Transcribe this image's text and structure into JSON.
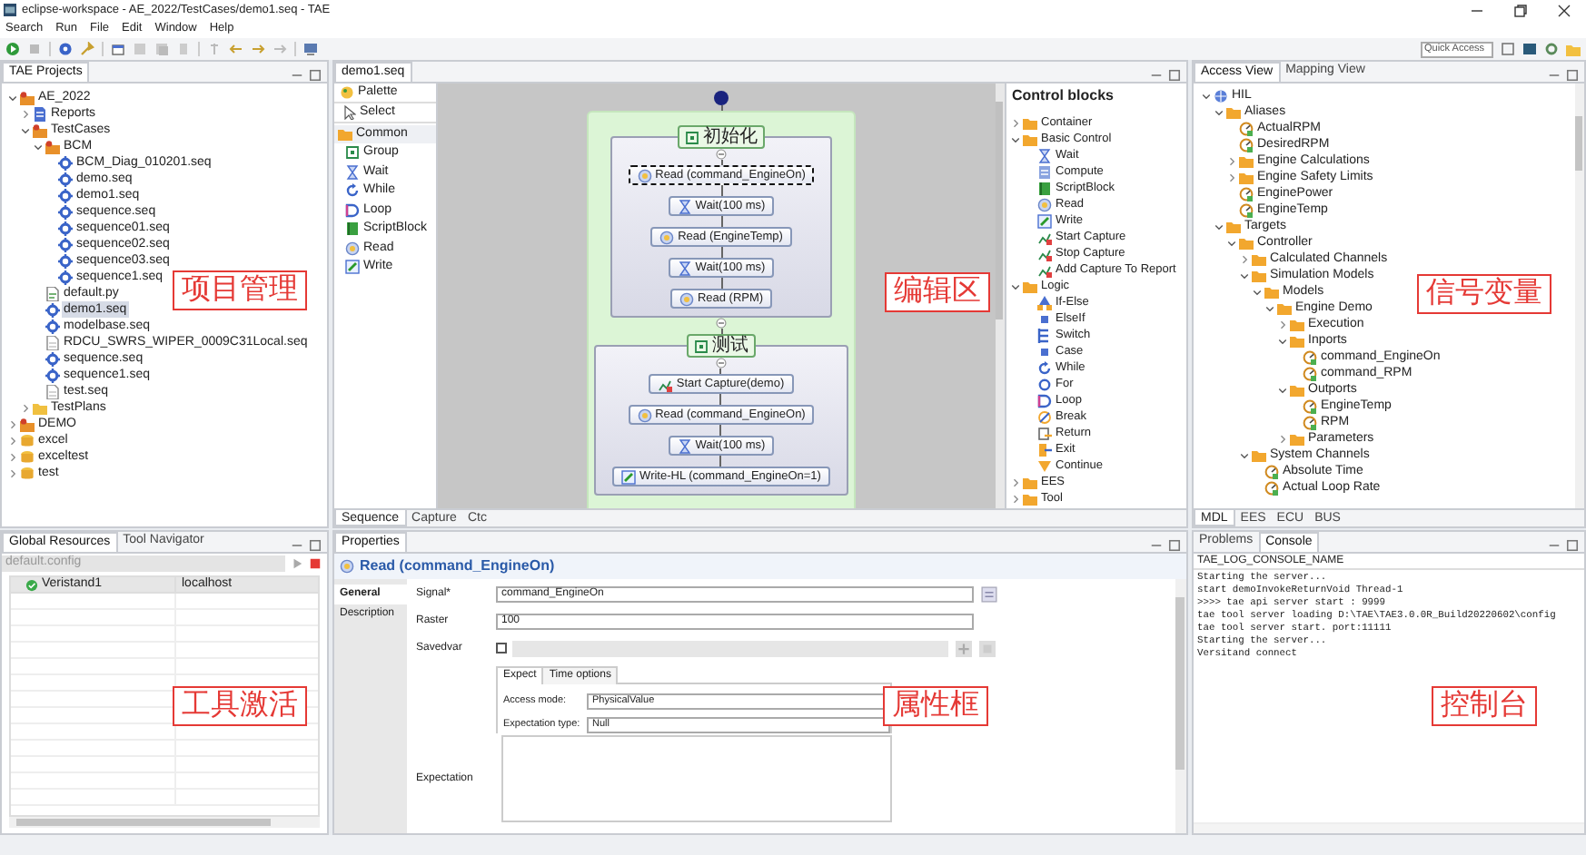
{
  "window": {
    "title": "eclipse-workspace - AE_2022/TestCases/demo1.seq - TAE"
  },
  "menu": [
    "Search",
    "Run",
    "File",
    "Edit",
    "Window",
    "Help"
  ],
  "quick_access": {
    "placeholder": "Quick Access"
  },
  "projects": {
    "tabs": [
      {
        "label": "TAE Projects",
        "selected": true
      }
    ],
    "annotation": "项目管理",
    "tree": [
      {
        "label": "AE_2022",
        "kind": "project",
        "expanded": true,
        "selected": false,
        "children": [
          {
            "label": "Reports",
            "kind": "report",
            "expanded": false,
            "selected": false
          },
          {
            "label": "TestCases",
            "kind": "project",
            "expanded": true,
            "selected": false,
            "children": [
              {
                "label": "BCM",
                "kind": "project",
                "expanded": true,
                "selected": false,
                "children": [
                  {
                    "label": "BCM_Diag_010201.seq",
                    "kind": "seq",
                    "selected": false
                  },
                  {
                    "label": "demo.seq",
                    "kind": "seq",
                    "selected": false
                  },
                  {
                    "label": "demo1.seq",
                    "kind": "seq",
                    "selected": false
                  },
                  {
                    "label": "sequence.seq",
                    "kind": "seq",
                    "selected": false
                  },
                  {
                    "label": "sequence01.seq",
                    "kind": "seq",
                    "selected": false
                  },
                  {
                    "label": "sequence02.seq",
                    "kind": "seq",
                    "selected": false
                  },
                  {
                    "label": "sequence03.seq",
                    "kind": "seq",
                    "selected": false
                  },
                  {
                    "label": "sequence1.seq",
                    "kind": "seq",
                    "selected": false
                  }
                ]
              },
              {
                "label": "default.py",
                "kind": "py",
                "selected": false
              },
              {
                "label": "demo1.seq",
                "kind": "seq",
                "selected": true
              },
              {
                "label": "modelbase.seq",
                "kind": "seq",
                "selected": false
              },
              {
                "label": "RDCU_SWRS_WIPER_0009C31Local.seq",
                "kind": "file",
                "selected": false
              },
              {
                "label": "sequence.seq",
                "kind": "seq",
                "selected": false
              },
              {
                "label": "sequence1.seq",
                "kind": "seq",
                "selected": false
              },
              {
                "label": "test.seq",
                "kind": "file",
                "selected": false
              }
            ]
          },
          {
            "label": "TestPlans",
            "kind": "plan",
            "expanded": false,
            "selected": false
          }
        ]
      },
      {
        "label": "DEMO",
        "kind": "project",
        "expanded": false,
        "selected": false
      },
      {
        "label": "excel",
        "kind": "db",
        "expanded": false,
        "selected": false
      },
      {
        "label": "exceltest",
        "kind": "db",
        "expanded": false,
        "selected": false
      },
      {
        "label": "test",
        "kind": "db",
        "expanded": false,
        "selected": false
      }
    ]
  },
  "editor": {
    "tabs": [
      {
        "label": "demo1.seq",
        "selected": true
      }
    ],
    "annotation": "编辑区",
    "palette": {
      "title": "Palette",
      "select": "Select",
      "drawer": "Common",
      "items": [
        {
          "label": "Group",
          "kind": "group"
        },
        {
          "label": "Wait",
          "kind": "hourglass"
        },
        {
          "label": "While",
          "kind": "loop"
        },
        {
          "label": "Loop",
          "kind": "loopd"
        },
        {
          "label": "ScriptBlock",
          "kind": "script"
        },
        {
          "label": "Read",
          "kind": "read"
        },
        {
          "label": "Write",
          "kind": "write"
        }
      ]
    },
    "diagram": {
      "groups": [
        {
          "label": "初始化",
          "nodes": [
            {
              "label": "Read (command_EngineOn)",
              "kind": "read",
              "selected": true
            },
            {
              "label": "Wait(100 ms)",
              "kind": "hourglass",
              "selected": false
            },
            {
              "label": "Read (EngineTemp)",
              "kind": "read",
              "selected": false
            },
            {
              "label": "Wait(100 ms)",
              "kind": "hourglass",
              "selected": false
            },
            {
              "label": "Read (RPM)",
              "kind": "read",
              "selected": false
            }
          ]
        },
        {
          "label": "测试",
          "nodes": [
            {
              "label": "Start Capture(demo)",
              "kind": "capture",
              "selected": false
            },
            {
              "label": "Read (command_EngineOn)",
              "kind": "read",
              "selected": false
            },
            {
              "label": "Wait(100 ms)",
              "kind": "hourglass",
              "selected": false
            },
            {
              "label": "Write-HL (command_EngineOn=1)",
              "kind": "write",
              "selected": false
            }
          ]
        }
      ]
    },
    "bottom_tabs": [
      {
        "label": "Sequence",
        "selected": true
      },
      {
        "label": "Capture",
        "selected": false
      },
      {
        "label": "Ctc",
        "selected": false
      }
    ],
    "control_blocks": {
      "title": "Control blocks",
      "tree": [
        {
          "label": "Container",
          "kind": "folder",
          "expanded": false
        },
        {
          "label": "Basic Control",
          "kind": "folder",
          "expanded": true,
          "children": [
            {
              "label": "Wait",
              "kind": "hourglass"
            },
            {
              "label": "Compute",
              "kind": "compute"
            },
            {
              "label": "ScriptBlock",
              "kind": "script"
            },
            {
              "label": "Read",
              "kind": "read"
            },
            {
              "label": "Write",
              "kind": "write"
            },
            {
              "label": "Start Capture",
              "kind": "capture"
            },
            {
              "label": "Stop Capture",
              "kind": "capture"
            },
            {
              "label": "Add Capture To Report",
              "kind": "capture"
            }
          ]
        },
        {
          "label": "Logic",
          "kind": "folder",
          "expanded": true,
          "children": [
            {
              "label": "If-Else",
              "kind": "fork"
            },
            {
              "label": "ElseIf",
              "kind": "square"
            },
            {
              "label": "Switch",
              "kind": "switch"
            },
            {
              "label": "Case",
              "kind": "square"
            },
            {
              "label": "While",
              "kind": "loop"
            },
            {
              "label": "For",
              "kind": "ring"
            },
            {
              "label": "Loop",
              "kind": "loopd"
            },
            {
              "label": "Break",
              "kind": "break"
            },
            {
              "label": "Return",
              "kind": "return"
            },
            {
              "label": "Exit",
              "kind": "exit"
            },
            {
              "label": "Continue",
              "kind": "continue"
            }
          ]
        },
        {
          "label": "EES",
          "kind": "folder",
          "expanded": false
        },
        {
          "label": "Tool",
          "kind": "folder",
          "expanded": false
        }
      ]
    }
  },
  "access": {
    "tabs": [
      {
        "label": "Access View",
        "selected": true
      },
      {
        "label": "Mapping View",
        "selected": false
      }
    ],
    "annotation": "信号变量",
    "tree": [
      {
        "label": "HIL",
        "kind": "hil",
        "expanded": true,
        "children": [
          {
            "label": "Aliases",
            "kind": "folder",
            "expanded": true,
            "children": [
              {
                "label": "ActualRPM",
                "kind": "signal"
              },
              {
                "label": "DesiredRPM",
                "kind": "signal"
              },
              {
                "label": "Engine Calculations",
                "kind": "folder",
                "expanded": false
              },
              {
                "label": "Engine Safety Limits",
                "kind": "folder",
                "expanded": false
              },
              {
                "label": "EnginePower",
                "kind": "signal"
              },
              {
                "label": "EngineTemp",
                "kind": "signal"
              }
            ]
          },
          {
            "label": "Targets",
            "kind": "folder",
            "expanded": true,
            "children": [
              {
                "label": "Controller",
                "kind": "folder",
                "expanded": true,
                "children": [
                  {
                    "label": "Calculated Channels",
                    "kind": "folder",
                    "expanded": false
                  },
                  {
                    "label": "Simulation Models",
                    "kind": "folder",
                    "expanded": true,
                    "children": [
                      {
                        "label": "Models",
                        "kind": "folder",
                        "expanded": true,
                        "children": [
                          {
                            "label": "Engine Demo",
                            "kind": "folder",
                            "expanded": true,
                            "children": [
                              {
                                "label": "Execution",
                                "kind": "folder",
                                "expanded": false
                              },
                              {
                                "label": "Inports",
                                "kind": "folder",
                                "expanded": true,
                                "children": [
                                  {
                                    "label": "command_EngineOn",
                                    "kind": "signal"
                                  },
                                  {
                                    "label": "command_RPM",
                                    "kind": "signal"
                                  }
                                ]
                              },
                              {
                                "label": "Outports",
                                "kind": "folder",
                                "expanded": true,
                                "children": [
                                  {
                                    "label": "EngineTemp",
                                    "kind": "signal"
                                  },
                                  {
                                    "label": "RPM",
                                    "kind": "signal"
                                  }
                                ]
                              },
                              {
                                "label": "Parameters",
                                "kind": "folder",
                                "expanded": false
                              }
                            ]
                          }
                        ]
                      }
                    ]
                  },
                  {
                    "label": "System Channels",
                    "kind": "folder",
                    "expanded": true,
                    "children": [
                      {
                        "label": "Absolute Time",
                        "kind": "signal"
                      },
                      {
                        "label": "Actual Loop Rate",
                        "kind": "signal"
                      }
                    ]
                  }
                ]
              }
            ]
          }
        ]
      }
    ],
    "bottom_tabs": [
      {
        "label": "MDL",
        "selected": true
      },
      {
        "label": "EES",
        "selected": false
      },
      {
        "label": "ECU",
        "selected": false
      },
      {
        "label": "BUS",
        "selected": false
      }
    ]
  },
  "resources": {
    "tabs": [
      {
        "label": "Global Resources",
        "selected": true
      },
      {
        "label": "Tool Navigator",
        "selected": false
      }
    ],
    "annotation": "工具激活",
    "config": {
      "value": "default.config",
      "disabled": true
    },
    "rows": [
      {
        "name": "Veristand1",
        "host": "localhost",
        "connected": true
      }
    ]
  },
  "properties": {
    "tabs": [
      {
        "label": "Properties",
        "selected": true
      }
    ],
    "annotation": "属性框",
    "title": "Read (command_EngineOn)",
    "side_tabs": [
      {
        "label": "General",
        "selected": true
      },
      {
        "label": "Description",
        "selected": false
      }
    ],
    "signal": {
      "label": "Signal*",
      "value": "command_EngineOn"
    },
    "raster": {
      "label": "Raster",
      "value": "100"
    },
    "savedvar": {
      "label": "Savedvar",
      "checked": false
    },
    "expect_tabs": [
      {
        "label": "Expect",
        "selected": true
      },
      {
        "label": "Time options",
        "selected": false
      }
    ],
    "access_mode": {
      "label": "Access mode:",
      "value": "PhysicalValue"
    },
    "expectation_type": {
      "label": "Expectation type:",
      "value": "Null"
    },
    "expectation": {
      "label": "Expectation"
    }
  },
  "console": {
    "tabs": [
      {
        "label": "Problems",
        "selected": false
      },
      {
        "label": "Console",
        "selected": true
      }
    ],
    "annotation": "控制台",
    "name": "TAE_LOG_CONSOLE_NAME",
    "lines": [
      "Starting the server...",
      "start demoInvokeReturnVoid Thread-1",
      ">>>> tae api server start : 9999",
      "tae tool server loading D:\\TAE\\TAE3.0.0R_Build20220602\\config",
      "tae tool server start. port:11111",
      "Starting the server...",
      "Versitand connect"
    ]
  }
}
